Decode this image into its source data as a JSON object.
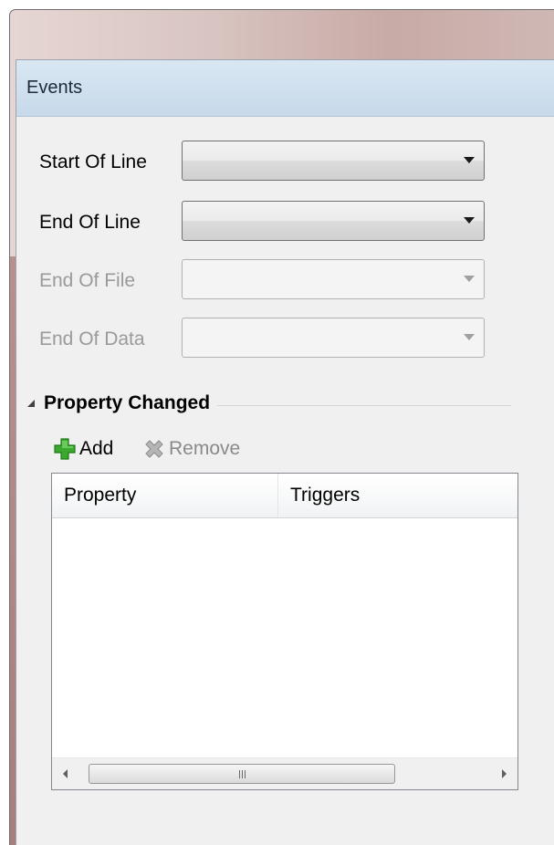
{
  "panel": {
    "title": "Events"
  },
  "events": {
    "start_of_line": {
      "label": "Start Of Line",
      "value": "",
      "enabled": true
    },
    "end_of_line": {
      "label": "End Of Line",
      "value": "",
      "enabled": true
    },
    "end_of_file": {
      "label": "End Of File",
      "value": "",
      "enabled": false
    },
    "end_of_data": {
      "label": "End Of Data",
      "value": "",
      "enabled": false
    }
  },
  "property_changed": {
    "title": "Property Changed",
    "toolbar": {
      "add_label": "Add",
      "remove_label": "Remove"
    },
    "columns": [
      "Property",
      "Triggers"
    ],
    "rows": []
  },
  "colors": {
    "header_bg": "#c7d9ea",
    "panel_bg": "#f0f0f0",
    "add_icon": "#3aa92e",
    "remove_icon": "#9a9a9a",
    "disabled_text": "#9a9a9a"
  },
  "icons": {
    "add": "plus-icon",
    "remove": "x-icon",
    "expander": "collapse-triangle-icon"
  }
}
